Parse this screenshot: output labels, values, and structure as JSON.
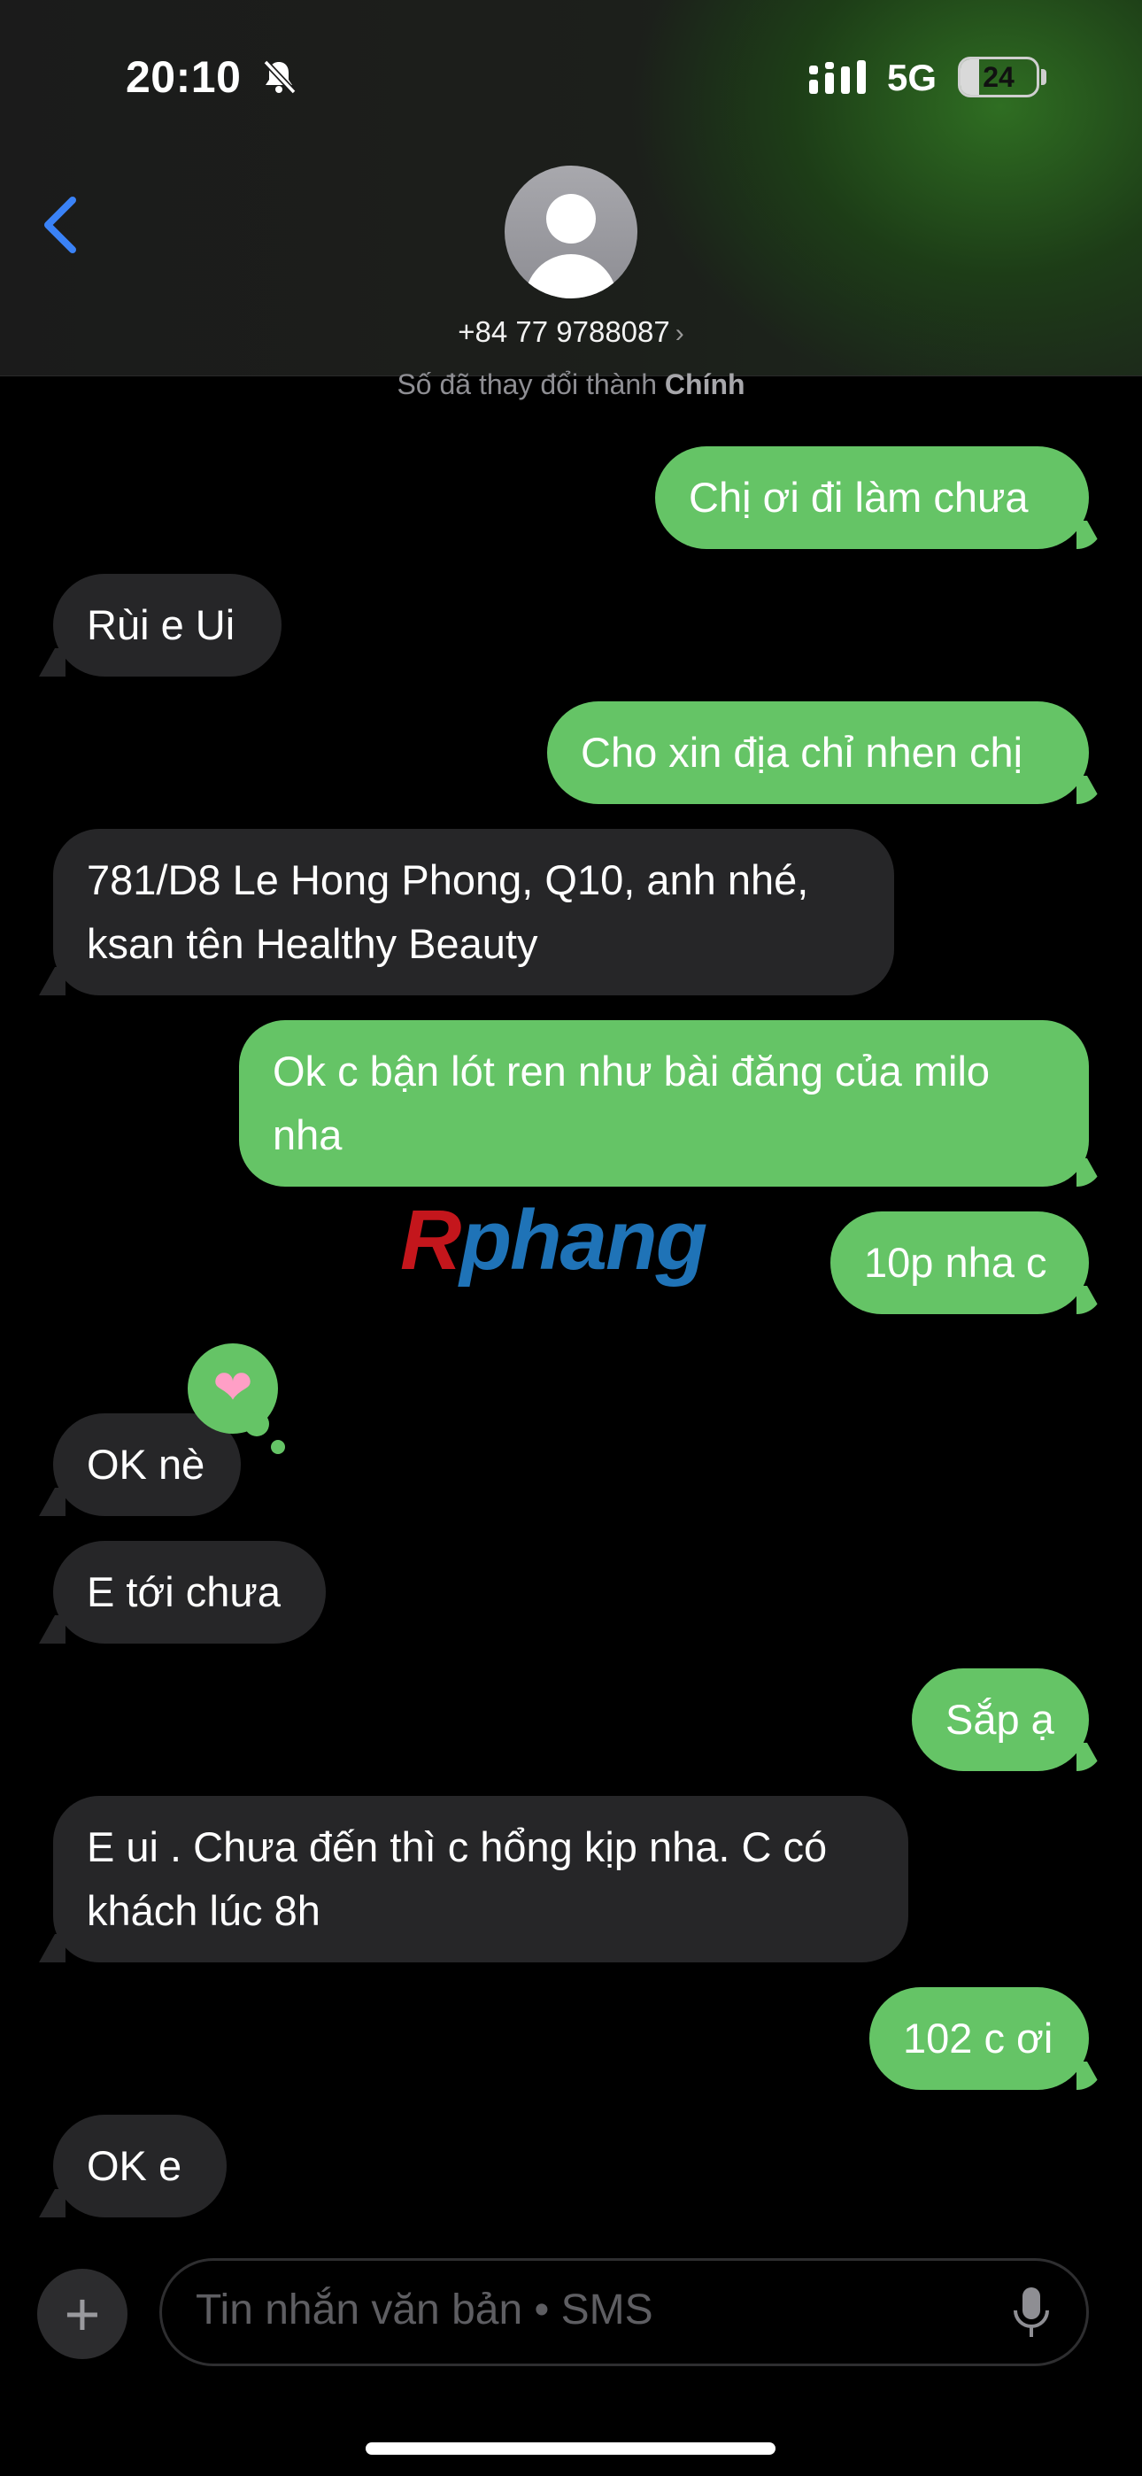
{
  "status_bar": {
    "time": "20:10",
    "network": "5G",
    "battery": "24",
    "battery_level": 0.24
  },
  "header": {
    "contact": "+84 77 9788087",
    "chevron": "›"
  },
  "system_note": {
    "prefix": "Số đã thay đổi thành",
    "emphasis": "Chính"
  },
  "messages": [
    {
      "dir": "out",
      "lines": [
        "Chị ơi đi làm chưa"
      ]
    },
    {
      "dir": "in",
      "lines": [
        "Rùi e Ui"
      ]
    },
    {
      "dir": "out",
      "lines": [
        "Cho xin địa chỉ nhen chị"
      ]
    },
    {
      "dir": "in",
      "lines": [
        "781/D8 Le Hong Phong, Q10, anh nhé,",
        "ksan tên Healthy Beauty"
      ]
    },
    {
      "dir": "out",
      "lines": [
        "Ok c bận lót ren như bài đăng của milo",
        "nha"
      ]
    },
    {
      "dir": "out",
      "lines": [
        "10p nha c"
      ]
    },
    {
      "dir": "in",
      "lines": [
        "OK nè"
      ],
      "reaction": "heart"
    },
    {
      "dir": "in",
      "lines": [
        "E tới chưa"
      ]
    },
    {
      "dir": "out",
      "lines": [
        "Sắp ạ"
      ]
    },
    {
      "dir": "in",
      "lines": [
        "E ui . Chưa đến thì c hổng kịp nha. C có",
        "khách lúc 8h"
      ]
    },
    {
      "dir": "out",
      "lines": [
        "102 c ơi"
      ]
    },
    {
      "dir": "in",
      "lines": [
        "OK e"
      ]
    }
  ],
  "reaction_icon": "heart-icon",
  "watermark": {
    "first": "R",
    "rest": "phang"
  },
  "composer": {
    "placeholder": "Tin nhắn văn bản • SMS",
    "plus": "+"
  },
  "icons": [
    "bell-slash-icon",
    "signal-icon",
    "battery-icon",
    "back-chevron-icon",
    "avatar-icon",
    "heart-icon",
    "plus-icon",
    "mic-icon"
  ],
  "colors": {
    "outgoing": "#65c466",
    "incoming": "#262628",
    "accent": "#3a82f7"
  }
}
